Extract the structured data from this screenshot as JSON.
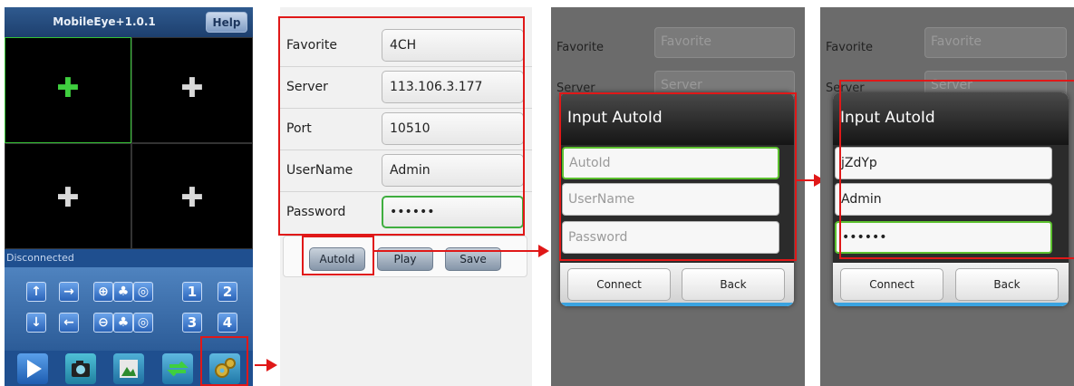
{
  "main_screen": {
    "app_title": "MobileEye+1.0.1",
    "help_label": "Help",
    "plus_glyph": "✚",
    "status_text": "Disconnected",
    "ptz_row1": [
      "↑",
      "→",
      "⊕",
      "♣",
      "◎"
    ],
    "ptz_row2": [
      "↓",
      "←",
      "⊖",
      "♣",
      "◎"
    ],
    "num_row1": [
      "1",
      "2"
    ],
    "num_row2": [
      "3",
      "4"
    ],
    "toolbar_icons": [
      "play-icon",
      "camera-icon",
      "picture-icon",
      "switch-icon",
      "settings-icon"
    ]
  },
  "settings_form": {
    "fields": [
      {
        "label": "Favorite",
        "value": "4CH"
      },
      {
        "label": "Server",
        "value": "113.106.3.177"
      },
      {
        "label": "Port",
        "value": "10510"
      },
      {
        "label": "UserName",
        "value": "Admin"
      },
      {
        "label": "Password",
        "value": "••••••"
      }
    ],
    "buttons": {
      "autoid": "AutoId",
      "play": "Play",
      "save": "Save"
    }
  },
  "background_form": {
    "favorite_label": "Favorite",
    "favorite_placeholder": "Favorite",
    "server_label": "Server",
    "server_placeholder": "Server"
  },
  "dialog_empty": {
    "title": "Input AutoId",
    "autoid_placeholder": "AutoId",
    "username_placeholder": "UserName",
    "password_placeholder": "Password",
    "connect_label": "Connect",
    "back_label": "Back"
  },
  "dialog_filled": {
    "title": "Input AutoId",
    "autoid_value": "jZdYp",
    "username_value": "Admin",
    "password_value": "••••••",
    "connect_label": "Connect",
    "back_label": "Back"
  },
  "colors": {
    "annotation": "#e01818",
    "focus": "#3fae3f",
    "header_blue": "#2f5a8f"
  }
}
